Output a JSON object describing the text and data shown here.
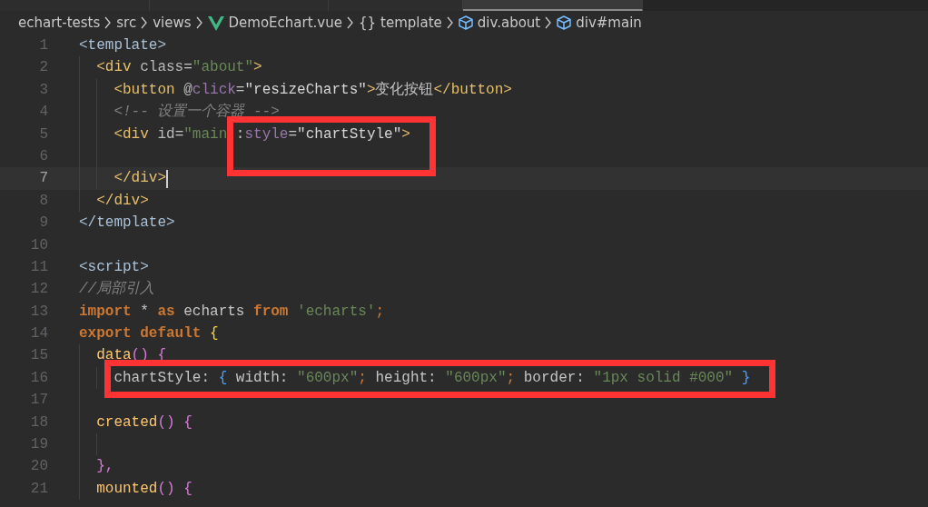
{
  "tabs": [
    {
      "selected": false
    },
    {
      "selected": false
    },
    {
      "selected": false
    },
    {
      "selected": true
    }
  ],
  "breadcrumb": [
    {
      "kind": "folder",
      "text": "echart-tests"
    },
    {
      "kind": "folder",
      "text": "src"
    },
    {
      "kind": "folder",
      "text": "views"
    },
    {
      "kind": "vue-file",
      "text": "DemoEchart.vue"
    },
    {
      "kind": "braces",
      "glyph": "{}",
      "text": "template"
    },
    {
      "kind": "element",
      "text": "div.about"
    },
    {
      "kind": "element",
      "text": "div#main"
    }
  ],
  "lines": [
    {
      "number": "1",
      "current": false,
      "boxed": false,
      "tokens": [
        {
          "text": "<template>",
          "kind": "tag-root"
        }
      ],
      "children": [
        {
          "number": "2",
          "current": false,
          "boxed": false,
          "tokens": [
            {
              "text": "<div",
              "kind": "tag"
            },
            {
              "text": " class",
              "kind": "attr"
            },
            {
              "text": "=",
              "kind": "text"
            },
            {
              "text": "\"about\"",
              "kind": "string"
            },
            {
              "text": ">",
              "kind": "tag"
            }
          ],
          "children": [
            {
              "number": "3",
              "current": false,
              "boxed": false,
              "tokens": [
                {
                  "text": "<button",
                  "kind": "tag"
                },
                {
                  "text": " @",
                  "kind": "attr"
                },
                {
                  "text": "click",
                  "kind": "directive"
                },
                {
                  "text": "=",
                  "kind": "text"
                },
                {
                  "text": "\"resizeCharts\"",
                  "kind": "string-light"
                },
                {
                  "text": ">",
                  "kind": "tag"
                },
                {
                  "text": "变化按钮",
                  "kind": "text"
                },
                {
                  "text": "</button>",
                  "kind": "tag"
                }
              ]
            },
            {
              "number": "4",
              "current": false,
              "boxed": false,
              "tokens": [
                {
                  "text": "<!-- 设置一个容器 -->",
                  "kind": "comment"
                }
              ]
            },
            {
              "number": "5",
              "current": false,
              "boxed": true,
              "tokens": [
                {
                  "text": "<div",
                  "kind": "tag"
                },
                {
                  "text": " id",
                  "kind": "attr"
                },
                {
                  "text": "=",
                  "kind": "text"
                },
                {
                  "text": "\"main ",
                  "kind": "string"
                },
                {
                  "text": ":",
                  "kind": "text",
                  "boxed": true
                },
                {
                  "text": "style",
                  "kind": "directive",
                  "boxed": true
                },
                {
                  "text": "=",
                  "kind": "text",
                  "boxed": true
                },
                {
                  "text": "\"chartStyle\"",
                  "kind": "string-light",
                  "boxed": true
                },
                {
                  "text": ">",
                  "kind": "tag",
                  "boxed": true
                }
              ]
            },
            {
              "number": "6",
              "current": false,
              "boxed": true
            },
            {
              "number": "7",
              "current": true,
              "boxed": false,
              "tokens": [
                {
                  "text": "</div>",
                  "kind": "tag"
                }
              ]
            }
          ]
        },
        {
          "number": "8",
          "current": false,
          "boxed": false,
          "tokens": [
            {
              "text": "</div>",
              "kind": "tag"
            }
          ]
        }
      ]
    },
    {
      "number": "9",
      "current": false,
      "boxed": false,
      "tokens": [
        {
          "text": "</template>",
          "kind": "tag-root"
        }
      ]
    },
    {
      "number": "10",
      "current": false,
      "boxed": false
    },
    {
      "number": "11",
      "current": false,
      "boxed": false,
      "tokens": [
        {
          "text": "<script>",
          "kind": "tag-root"
        }
      ]
    },
    {
      "number": "12",
      "current": false,
      "boxed": false,
      "tokens": [
        {
          "text": "//局部引入",
          "kind": "comment"
        }
      ]
    },
    {
      "number": "13",
      "current": false,
      "boxed": false,
      "tokens": [
        {
          "text": "import",
          "kind": "keyword"
        },
        {
          "text": " * ",
          "kind": "text"
        },
        {
          "text": "as",
          "kind": "keyword"
        },
        {
          "text": " echarts ",
          "kind": "text"
        },
        {
          "text": "from",
          "kind": "keyword"
        },
        {
          "text": " 'echarts'",
          "kind": "string"
        },
        {
          "text": ";",
          "kind": "punct"
        }
      ]
    },
    {
      "number": "14",
      "current": false,
      "boxed": false,
      "tokens": [
        {
          "text": "export",
          "kind": "keyword"
        },
        {
          "text": " default",
          "kind": "keyword"
        },
        {
          "text": " {",
          "kind": "brace"
        }
      ],
      "children": [
        {
          "number": "15",
          "current": false,
          "boxed": false,
          "tokens": [
            {
              "text": "data",
              "kind": "method"
            },
            {
              "text": "() {",
              "kind": "paren"
            }
          ],
          "children": [
            {
              "number": "16",
              "current": false,
              "boxed": true,
              "tokens": [
                {
                  "text": "chartStyle: ",
                  "kind": "text",
                  "boxed": true
                },
                {
                  "text": "{",
                  "kind": "brace-blue",
                  "boxed": true
                },
                {
                  "text": " width: ",
                  "kind": "text",
                  "boxed": true
                },
                {
                  "text": "\"600px\"",
                  "kind": "string",
                  "boxed": true
                },
                {
                  "text": ";",
                  "kind": "punct",
                  "boxed": true
                },
                {
                  "text": " height: ",
                  "kind": "text",
                  "boxed": true
                },
                {
                  "text": "\"600px\"",
                  "kind": "string",
                  "boxed": true
                },
                {
                  "text": ";",
                  "kind": "punct",
                  "boxed": true
                },
                {
                  "text": " border: ",
                  "kind": "text",
                  "boxed": true
                },
                {
                  "text": "\"1px solid #000\"",
                  "kind": "string",
                  "boxed": true
                },
                {
                  "text": " }",
                  "kind": "brace-blue",
                  "boxed": true
                }
              ]
            }
          ]
        },
        {
          "number": "17",
          "current": false,
          "boxed": false
        },
        {
          "number": "18",
          "current": false,
          "boxed": false,
          "tokens": [
            {
              "text": "created",
              "kind": "method"
            },
            {
              "text": "() {",
              "kind": "paren"
            }
          ],
          "children": [
            {
              "number": "19",
              "current": false,
              "boxed": false
            }
          ]
        },
        {
          "number": "20",
          "current": false,
          "boxed": false,
          "tokens": [
            {
              "text": "},",
              "kind": "paren"
            }
          ]
        },
        {
          "number": "21",
          "current": false,
          "boxed": false,
          "tokens": [
            {
              "text": "mounted",
              "kind": "method"
            },
            {
              "text": "() {",
              "kind": "paren"
            }
          ]
        }
      ]
    }
  ]
}
